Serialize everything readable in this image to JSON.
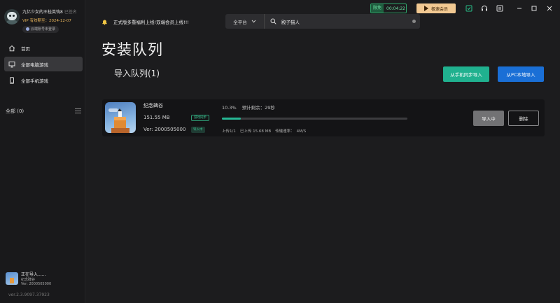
{
  "profile": {
    "name": "九亿少女的王桂英钩8",
    "name_tag": "已签名",
    "vip_text": "VIP 有效期至：2024-12-07",
    "bind_text": "云端账号未登录"
  },
  "sidebar": {
    "items": [
      {
        "label": "首页",
        "icon": "home-icon"
      },
      {
        "label": "全部电脑游戏",
        "icon": "monitor-icon"
      },
      {
        "label": "全部手机游戏",
        "icon": "phone-icon"
      }
    ],
    "all_label": "全部 (0)",
    "mini_task": {
      "status": "正在导入......",
      "name": "纪念碑谷",
      "version": "Ver: 2000505000"
    },
    "app_version": "ver.2.3.9097.37923"
  },
  "topbar": {
    "notice": "正式版多重福利上线!双端会员上线!!!",
    "search": {
      "platform": "全平台",
      "value": "殿子猫人"
    },
    "speed": {
      "tag": "限免",
      "time": "00:04:22"
    },
    "vip_button": "极速会员"
  },
  "main": {
    "page_title": "安装队列",
    "queue_title": "导入队列(1)",
    "btn_phone_sync": "从手机同步导入",
    "btn_pc_import": "从PC本地导入",
    "task": {
      "name": "纪念碑谷",
      "size": "151.55 MB",
      "version": "Ver: 2000505000",
      "sync_badge": "游戏同步",
      "importing_badge": "导入中",
      "progress_percent_text": "10.3%",
      "progress": 0.103,
      "eta": "预计剩余：29秒",
      "upload_count": "上传1/1",
      "uploaded": "已上传 15.68 MB",
      "rate": "传输速率：",
      "rate_value": "4M/S",
      "btn_importing": "导入中",
      "btn_delete": "删除"
    }
  },
  "colors": {
    "accent_green": "#20b18f",
    "accent_blue": "#1a6fd6",
    "vip_gold": "#f2c992",
    "progress": "#26b794"
  }
}
